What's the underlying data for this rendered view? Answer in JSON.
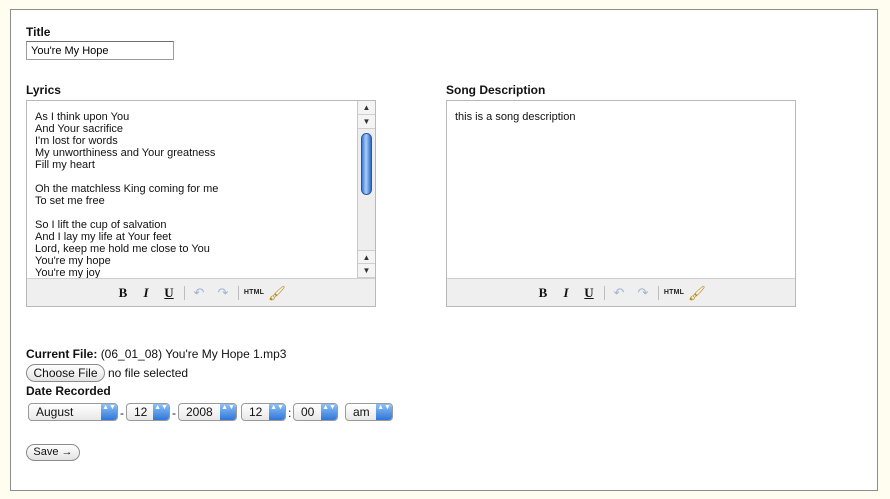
{
  "form": {
    "title_label": "Title",
    "title_value": "You're My Hope",
    "lyrics_label": "Lyrics",
    "lyrics_text": "As I think upon You\nAnd Your sacrifice\nI'm lost for words\nMy unworthiness and Your greatness\nFill my heart\n\nOh the matchless King coming for me\nTo set me free\n\nSo I lift the cup of salvation\nAnd I lay my life at Your feet\nLord, keep me hold me close to You\nYou're my hope\nYou're my joy",
    "description_label": "Song Description",
    "description_text": "this is a song description",
    "current_file_label": "Current File:",
    "current_file_value": "(06_01_08) You're My Hope 1.mp3",
    "choose_file_label": "Choose File",
    "file_status": "no file selected",
    "date_label": "Date Recorded",
    "month": "August",
    "day": "12",
    "year": "2008",
    "hour": "12",
    "minute": "00",
    "ampm": "am",
    "date_sep": "-",
    "time_sep": ":",
    "save_label": "Save →"
  },
  "toolbar": {
    "bold": "B",
    "italic": "I",
    "underline": "U",
    "undo": "↶",
    "redo": "↷",
    "html": "HTML",
    "cleanup": "🖌"
  },
  "icons": {
    "scroll_up": "▲",
    "scroll_down": "▼",
    "select_arrows": "▲▼"
  },
  "colors": {
    "page_background": "#fffdf0",
    "select_button": "#2f77d8",
    "scroll_thumb": "#3a79d8"
  }
}
